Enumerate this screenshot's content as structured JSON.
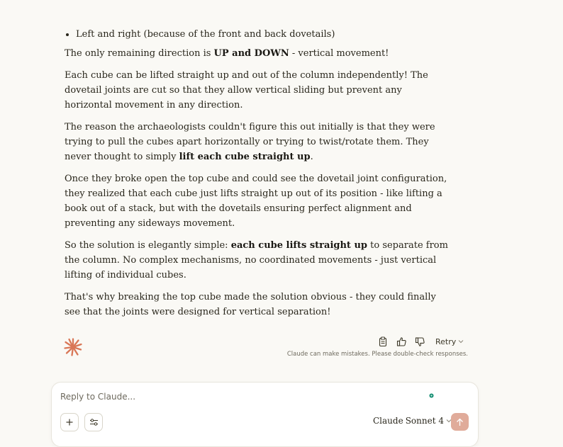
{
  "message": {
    "bullet": "Left and right (because of the front and back dovetails)",
    "p1": {
      "pre": "The only remaining direction is ",
      "bold": "UP and DOWN",
      "post": " - vertical movement!"
    },
    "p2": "Each cube can be lifted straight up and out of the column independently! The dovetail joints are cut so that they allow vertical sliding but prevent any horizontal movement in any direction.",
    "p3": {
      "pre": "The reason the archaeologists couldn't figure this out initially is that they were trying to pull the cubes apart horizontally or trying to twist/rotate them. They never thought to simply ",
      "bold": "lift each cube straight up",
      "post": "."
    },
    "p4": "Once they broke open the top cube and could see the dovetail joint configuration, they realized that each cube just lifts straight up out of its position - like lifting a book out of a stack, but with the dovetails ensuring perfect alignment and preventing any sideways movement.",
    "p5": {
      "pre": "So the solution is elegantly simple: ",
      "bold": "each cube lifts straight up",
      "post": " to separate from the column. No complex mechanisms, no coordinated movements - just vertical lifting of individual cubes."
    },
    "p6": "That's why breaking the top cube made the solution obvious - they could finally see that the joints were designed for vertical separation!"
  },
  "actions": {
    "copy_icon": "clipboard-icon",
    "like_icon": "thumbs-up-icon",
    "dislike_icon": "thumbs-down-icon",
    "retry_label": "Retry"
  },
  "disclaimer": "Claude can make mistakes. Please double-check responses.",
  "composer": {
    "placeholder": "Reply to Claude...",
    "model_name": "Claude",
    "model_version": "Sonnet 4"
  },
  "colors": {
    "background": "#faf9f5",
    "brand_spark": "#d97757",
    "send_button": "#e0ab9a",
    "status_dot": "#0f8a6e"
  }
}
